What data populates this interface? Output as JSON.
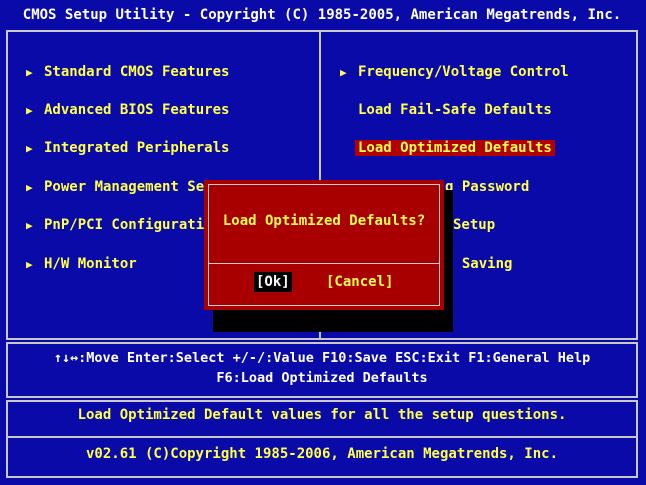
{
  "title": "CMOS Setup Utility - Copyright (C) 1985-2005, American Megatrends, Inc.",
  "left_menu": [
    {
      "label": "Standard CMOS Features"
    },
    {
      "label": "Advanced BIOS Features"
    },
    {
      "label": "Integrated Peripherals"
    },
    {
      "label": "Power Management Set"
    },
    {
      "label": "PnP/PCI Configuratio"
    },
    {
      "label": "H/W Monitor"
    }
  ],
  "right_menu": [
    {
      "label": "Frequency/Voltage Control"
    },
    {
      "label": "Load Fail-Safe Defaults"
    },
    {
      "label": "Load Optimized Defaults"
    },
    {
      "label": "g Password"
    },
    {
      "label": "Setup"
    },
    {
      "label": "t Saving"
    }
  ],
  "dialog": {
    "question": "Load Optimized Defaults?",
    "ok_label": "[Ok]",
    "cancel_label": "[Cancel]"
  },
  "help": {
    "line1": "↑↓↔:Move  Enter:Select  +/-/:Value  F10:Save  ESC:Exit  F1:General Help",
    "line2": "F6:Load Optimized Defaults"
  },
  "status": {
    "description": "Load Optimized Default values for all the setup questions.",
    "version": "v02.61 (C)Copyright 1985-2006, American Megatrends, Inc."
  },
  "icons": {
    "submenu_arrow": "▶"
  },
  "colors": {
    "background": "#0a0aa8",
    "text": "#ffff4c",
    "highlight": "#b00000",
    "dialog": "#a80000"
  }
}
